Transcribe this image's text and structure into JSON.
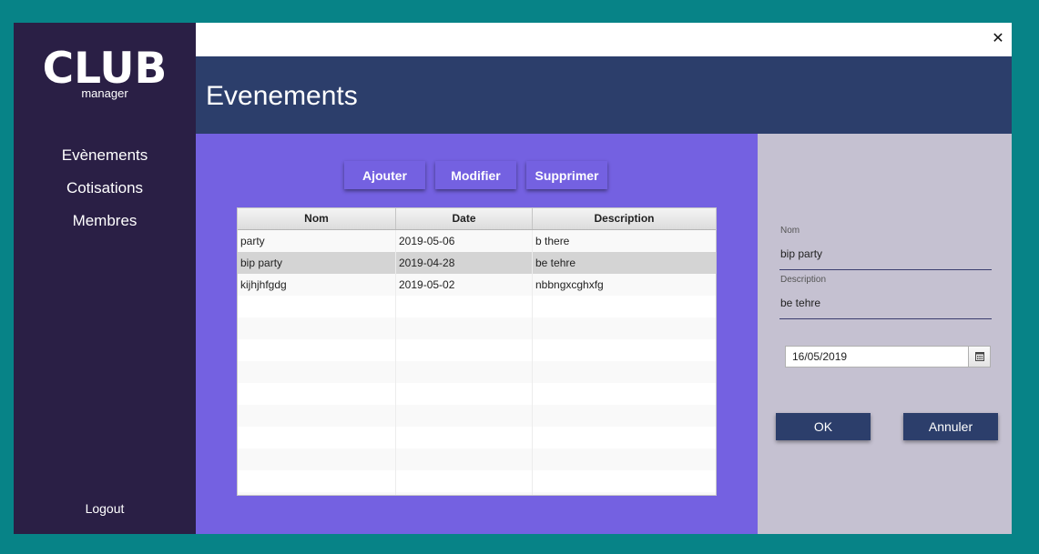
{
  "sidebar": {
    "logo_title": "CLUB",
    "logo_subtitle": "manager",
    "nav": [
      {
        "label": "Evènements"
      },
      {
        "label": "Cotisations"
      },
      {
        "label": "Membres"
      }
    ],
    "logout_label": "Logout"
  },
  "window": {
    "close_glyph": "✕"
  },
  "header": {
    "title": "Evenements"
  },
  "toolbar": {
    "add_label": "Ajouter",
    "edit_label": "Modifier",
    "delete_label": "Supprimer"
  },
  "table": {
    "columns": [
      "Nom",
      "Date",
      "Description"
    ],
    "rows": [
      {
        "nom": "party",
        "date": "2019-05-06",
        "description": "b there"
      },
      {
        "nom": "bip party",
        "date": "2019-04-28",
        "description": "be tehre"
      },
      {
        "nom": "kijhjhfgdg",
        "date": "2019-05-02",
        "description": "nbbngxcghxfg"
      }
    ],
    "selected_row": 1
  },
  "form": {
    "nom_label": "Nom",
    "nom_value": "bip party",
    "description_label": "Description",
    "description_value": "be tehre",
    "date_value": "16/05/2019",
    "ok_label": "OK",
    "cancel_label": "Annuler"
  },
  "colors": {
    "background": "#078387",
    "sidebar": "#2a1f45",
    "header": "#2c3e6b",
    "left_panel": "#7461e1",
    "right_panel": "#c5c1d1",
    "button_dark": "#2c3e6b"
  },
  "icons": {
    "close": "close-icon",
    "calendar": "calendar-icon"
  }
}
